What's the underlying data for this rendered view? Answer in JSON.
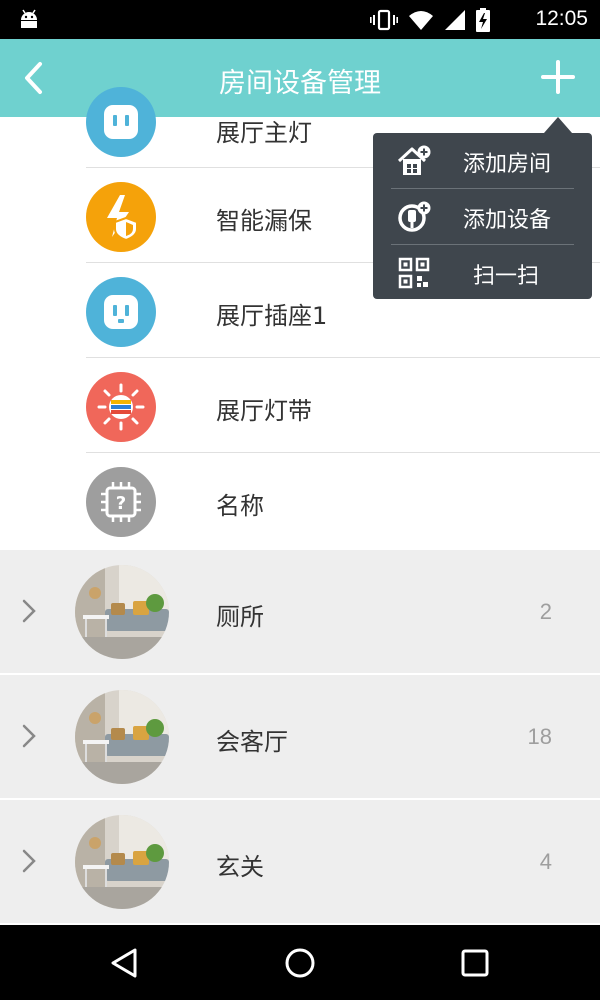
{
  "status_bar": {
    "time": "12:05"
  },
  "app_bar": {
    "title": "房间设备管理"
  },
  "devices": [
    {
      "label": "展厅主灯",
      "icon": "socket-icon",
      "color": "#4fb3d9"
    },
    {
      "label": "智能漏保",
      "icon": "lightning-shield-icon",
      "color": "#f5a20a"
    },
    {
      "label": "展厅插座1",
      "icon": "socket-icon",
      "color": "#4fb3d9"
    },
    {
      "label": "展厅灯带",
      "icon": "led-strip-icon",
      "color": "#f0675a"
    },
    {
      "label": "名称",
      "icon": "unknown-chip-icon",
      "color": "#9e9e9e"
    }
  ],
  "rooms": [
    {
      "name": "厕所",
      "count": "2"
    },
    {
      "name": "会客厅",
      "count": "18"
    },
    {
      "name": "玄关",
      "count": "4"
    }
  ],
  "popup_menu": {
    "items": [
      {
        "label": "添加房间",
        "icon": "add-room-icon"
      },
      {
        "label": "添加设备",
        "icon": "add-device-icon"
      },
      {
        "label": "扫一扫",
        "icon": "qr-scan-icon"
      }
    ]
  },
  "colors": {
    "app_bar": "#6fd1cf",
    "popup_bg": "#3f464d",
    "room_bg": "#eeeeee"
  }
}
